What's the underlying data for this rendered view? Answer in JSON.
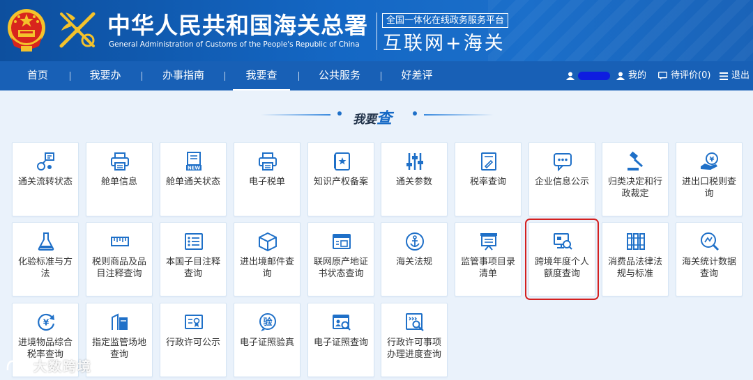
{
  "header": {
    "title_cn": "中华人民共和国海关总署",
    "title_en": "General Administration of Customs of the People's Republic of China",
    "platform_label": "全国一体化在线政务服务平台",
    "platform_name": "互联网+海关"
  },
  "nav": {
    "items": [
      "首页",
      "我要办",
      "办事指南",
      "我要查",
      "公共服务",
      "好差评"
    ],
    "active": "我要查",
    "user_link": "我的",
    "pending_eval": "待评价(0)",
    "logout": "退出"
  },
  "section": {
    "title_prefix": "我要",
    "title_emph": "查"
  },
  "tiles": [
    {
      "label": "通关流转状态",
      "icon": "flow-icon"
    },
    {
      "label": "舱单信息",
      "icon": "printer-icon"
    },
    {
      "label": "舱单通关状态",
      "icon": "new-doc-icon"
    },
    {
      "label": "电子税单",
      "icon": "printer-icon"
    },
    {
      "label": "知识产权备案",
      "icon": "ip-book-icon"
    },
    {
      "label": "通关参数",
      "icon": "sliders-icon"
    },
    {
      "label": "税率查询",
      "icon": "tax-doc-icon"
    },
    {
      "label": "企业信息公示",
      "icon": "chat-icon"
    },
    {
      "label": "归类决定和行政裁定",
      "icon": "gavel-icon"
    },
    {
      "label": "进出口税则查询",
      "icon": "yuan-hand-icon"
    },
    {
      "label": "化验标准与方法",
      "icon": "flask-icon"
    },
    {
      "label": "税则商品及品目注释查询",
      "icon": "ruler-icon"
    },
    {
      "label": "本国子目注释查询",
      "icon": "list-icon"
    },
    {
      "label": "进出境邮件查询",
      "icon": "box-icon"
    },
    {
      "label": "联网原产地证书状态查询",
      "icon": "certificate-icon"
    },
    {
      "label": "海关法规",
      "icon": "anchor-icon"
    },
    {
      "label": "监管事项目录清单",
      "icon": "monitor-icon"
    },
    {
      "label": "跨境年度个人额度查询",
      "icon": "screen-search-icon"
    },
    {
      "label": "消费品法律法规与标准",
      "icon": "books-icon"
    },
    {
      "label": "海关统计数据查询",
      "icon": "stats-search-icon"
    },
    {
      "label": "进境物品综合税率查询",
      "icon": "yuan-cycle-icon"
    },
    {
      "label": "指定监管场地查询",
      "icon": "site-icon"
    },
    {
      "label": "行政许可公示",
      "icon": "license-icon"
    },
    {
      "label": "电子证照验真",
      "icon": "verify-icon"
    },
    {
      "label": "电子证照查询",
      "icon": "id-card-search-icon"
    },
    {
      "label": "行政许可事项办理进度查询",
      "icon": "progress-search-icon"
    }
  ],
  "selected_tile": "跨境年度个人额度查询",
  "watermark": "大数跨境",
  "colors": {
    "nav": "#1860b6",
    "accent": "#1569c5",
    "selected_outline": "#d42020"
  }
}
